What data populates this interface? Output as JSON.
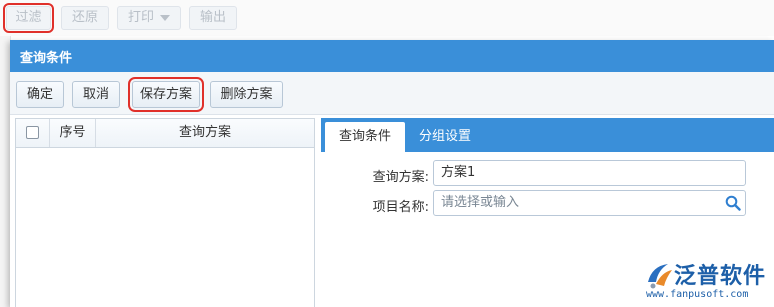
{
  "toolbar": {
    "filter_label": "过滤",
    "restore_label": "还原",
    "print_label": "打印",
    "export_label": "输出"
  },
  "dialog": {
    "title": "查询条件",
    "buttons": {
      "confirm": "确定",
      "cancel": "取消",
      "save_scheme": "保存方案",
      "delete_scheme": "删除方案"
    },
    "grid": {
      "columns": [
        "序号",
        "查询方案"
      ],
      "rows": []
    },
    "tabs": [
      {
        "label": "查询条件",
        "active": true
      },
      {
        "label": "分组设置",
        "active": false
      }
    ],
    "form": {
      "scheme_label": "查询方案:",
      "scheme_value": "方案1",
      "item_label": "项目名称:",
      "item_placeholder": "请选择或输入"
    }
  },
  "watermark": {
    "brand": "泛普软件",
    "url": "www.fanpusoft.com"
  },
  "colors": {
    "accent": "#3a8fd9",
    "highlight": "#e0302a",
    "brand": "#1d5fa8"
  }
}
